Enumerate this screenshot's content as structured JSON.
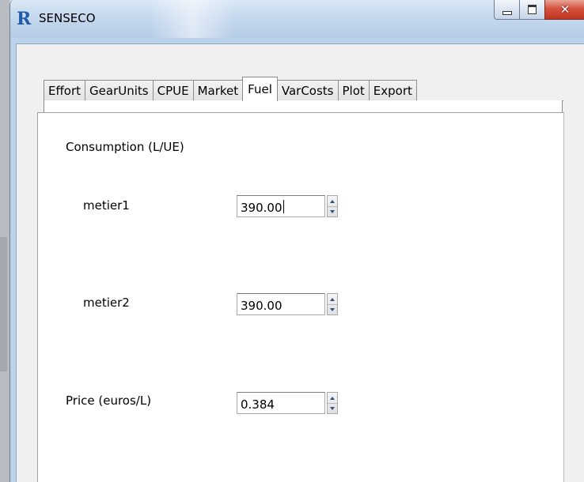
{
  "window": {
    "title": "SENSECO",
    "app_icon": "r-logo-icon",
    "controls": {
      "minimize": "minimize-icon",
      "maximize": "maximize-icon",
      "close": "close-icon"
    }
  },
  "tabs": [
    {
      "label": "Effort",
      "active": false
    },
    {
      "label": "GearUnits",
      "active": false
    },
    {
      "label": "CPUE",
      "active": false
    },
    {
      "label": "Market",
      "active": false
    },
    {
      "label": "Fuel",
      "active": true
    },
    {
      "label": "VarCosts",
      "active": false
    },
    {
      "label": "Plot",
      "active": false
    },
    {
      "label": "Export",
      "active": false
    }
  ],
  "fuel": {
    "consumption_label": "Consumption (L/UE)",
    "metier1": {
      "label": "metier1",
      "value": "390.00"
    },
    "metier2": {
      "label": "metier2",
      "value": "390.00"
    },
    "price": {
      "label": "Price (euros/L)",
      "value": "0.384"
    }
  },
  "colors": {
    "titlebar": "#c5d8ee",
    "close_button": "#c1341e",
    "spin_arrow": "#2d4f86"
  }
}
